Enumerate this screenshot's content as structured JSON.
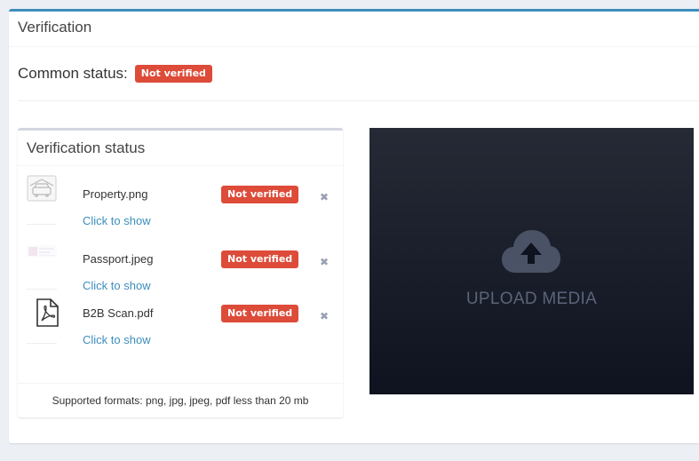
{
  "panel": {
    "title": "Verification"
  },
  "common": {
    "label": "Common status:",
    "badge": "Not verified",
    "badge_color": "#dd4b39"
  },
  "status_box": {
    "title": "Verification status",
    "files": [
      {
        "name": "Property.png",
        "link": "Click to show",
        "badge": "Not verified",
        "close": "✖",
        "thumb": "car-thumbnail"
      },
      {
        "name": "Passport.jpeg",
        "link": "Click to show",
        "badge": "Not verified",
        "close": "✖",
        "thumb": "passport-thumbnail"
      },
      {
        "name": "B2B Scan.pdf",
        "link": "Click to show",
        "badge": "Not verified",
        "close": "✖",
        "thumb": "pdf-icon"
      }
    ],
    "footer": "Supported formats: png, jpg, jpeg, pdf less than 20 mb"
  },
  "upload": {
    "label": "UPLOAD MEDIA",
    "icon": "cloud-upload-icon"
  },
  "colors": {
    "accent": "#3c8dbc",
    "danger": "#dd4b39",
    "link": "#3c8dbc"
  }
}
